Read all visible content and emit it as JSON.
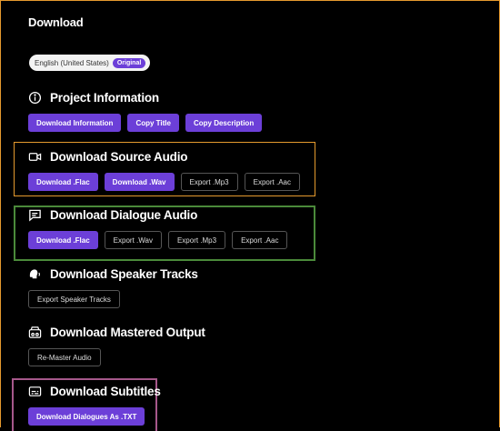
{
  "panel": {
    "title": "Download",
    "language": {
      "label": "English (United States)",
      "badge": "Original"
    }
  },
  "sections": {
    "project": {
      "label": "Project Information",
      "icon": "info-icon",
      "buttons": [
        "Download Information",
        "Copy Title",
        "Copy Description"
      ]
    },
    "source": {
      "label": "Download Source Audio",
      "icon": "video-camera-icon",
      "buttons": [
        "Download .Flac",
        "Download .Wav",
        "Export .Mp3",
        "Export .Aac"
      ]
    },
    "dialogue": {
      "label": "Download Dialogue Audio",
      "icon": "message-icon",
      "buttons": [
        "Download .Flac",
        "Export .Wav",
        "Export .Mp3",
        "Export .Aac"
      ]
    },
    "speaker": {
      "label": "Download Speaker Tracks",
      "icon": "speaker-head-icon",
      "buttons": [
        "Export Speaker Tracks"
      ]
    },
    "mastered": {
      "label": "Download Mastered Output",
      "icon": "radio-icon",
      "buttons": [
        "Re-Master Audio"
      ]
    },
    "subtitles": {
      "label": "Download Subtitles",
      "icon": "subtitles-icon",
      "buttons": [
        "Download Dialogues As .TXT"
      ]
    }
  },
  "colors": {
    "accent": "#6c3fd8",
    "highlight_orange": "#e59a2e",
    "highlight_green": "#4b8a3a",
    "highlight_magenta": "#a6588b"
  }
}
